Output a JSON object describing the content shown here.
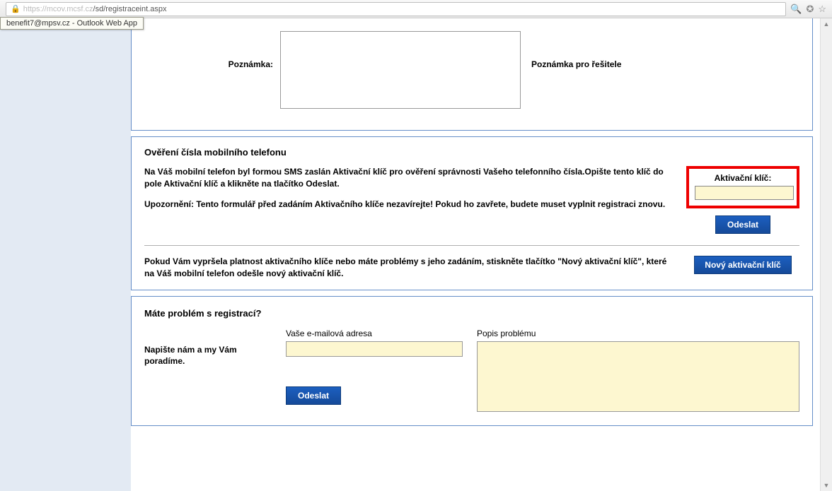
{
  "browser": {
    "url_prefix": "https",
    "url_host": "://mcov.mcsf.cz",
    "url_path": "/sd/registraceint.aspx",
    "tooltip": "benefit7@mpsv.cz - Outlook Web App"
  },
  "notes": {
    "left_label": "Poznámka:",
    "right_label": "Poznámka pro řešitele"
  },
  "verify": {
    "heading": "Ověření čísla mobilního telefonu",
    "para1": "Na Váš mobilní telefon byl formou SMS zaslán Aktivační klíč pro ověření správnosti Vašeho telefonního čísla.Opište tento klíč do pole Aktivační klíč a klikněte na tlačítko Odeslat.",
    "para2": "Upozornění: Tento formulář před zadáním Aktivačního klíče nezavírejte! Pokud ho zavřete, budete muset vyplnit registraci znovu.",
    "activation_label": "Aktivační klíč:",
    "send_button": "Odeslat",
    "newkey_text": "Pokud Vám vypršela platnost aktivačního klíče nebo máte problémy s jeho zadáním, stiskněte tlačítko \"Nový aktivační klíč\", které na Váš mobilní telefon odešle nový aktivační klíč.",
    "newkey_button": "Nový aktivační klíč"
  },
  "problem": {
    "heading": "Máte problém s registrací?",
    "help_text": "Napište nám a my Vám poradíme.",
    "email_label": "Vaše e-mailová adresa",
    "desc_label": "Popis problému",
    "send_button": "Odeslat"
  }
}
